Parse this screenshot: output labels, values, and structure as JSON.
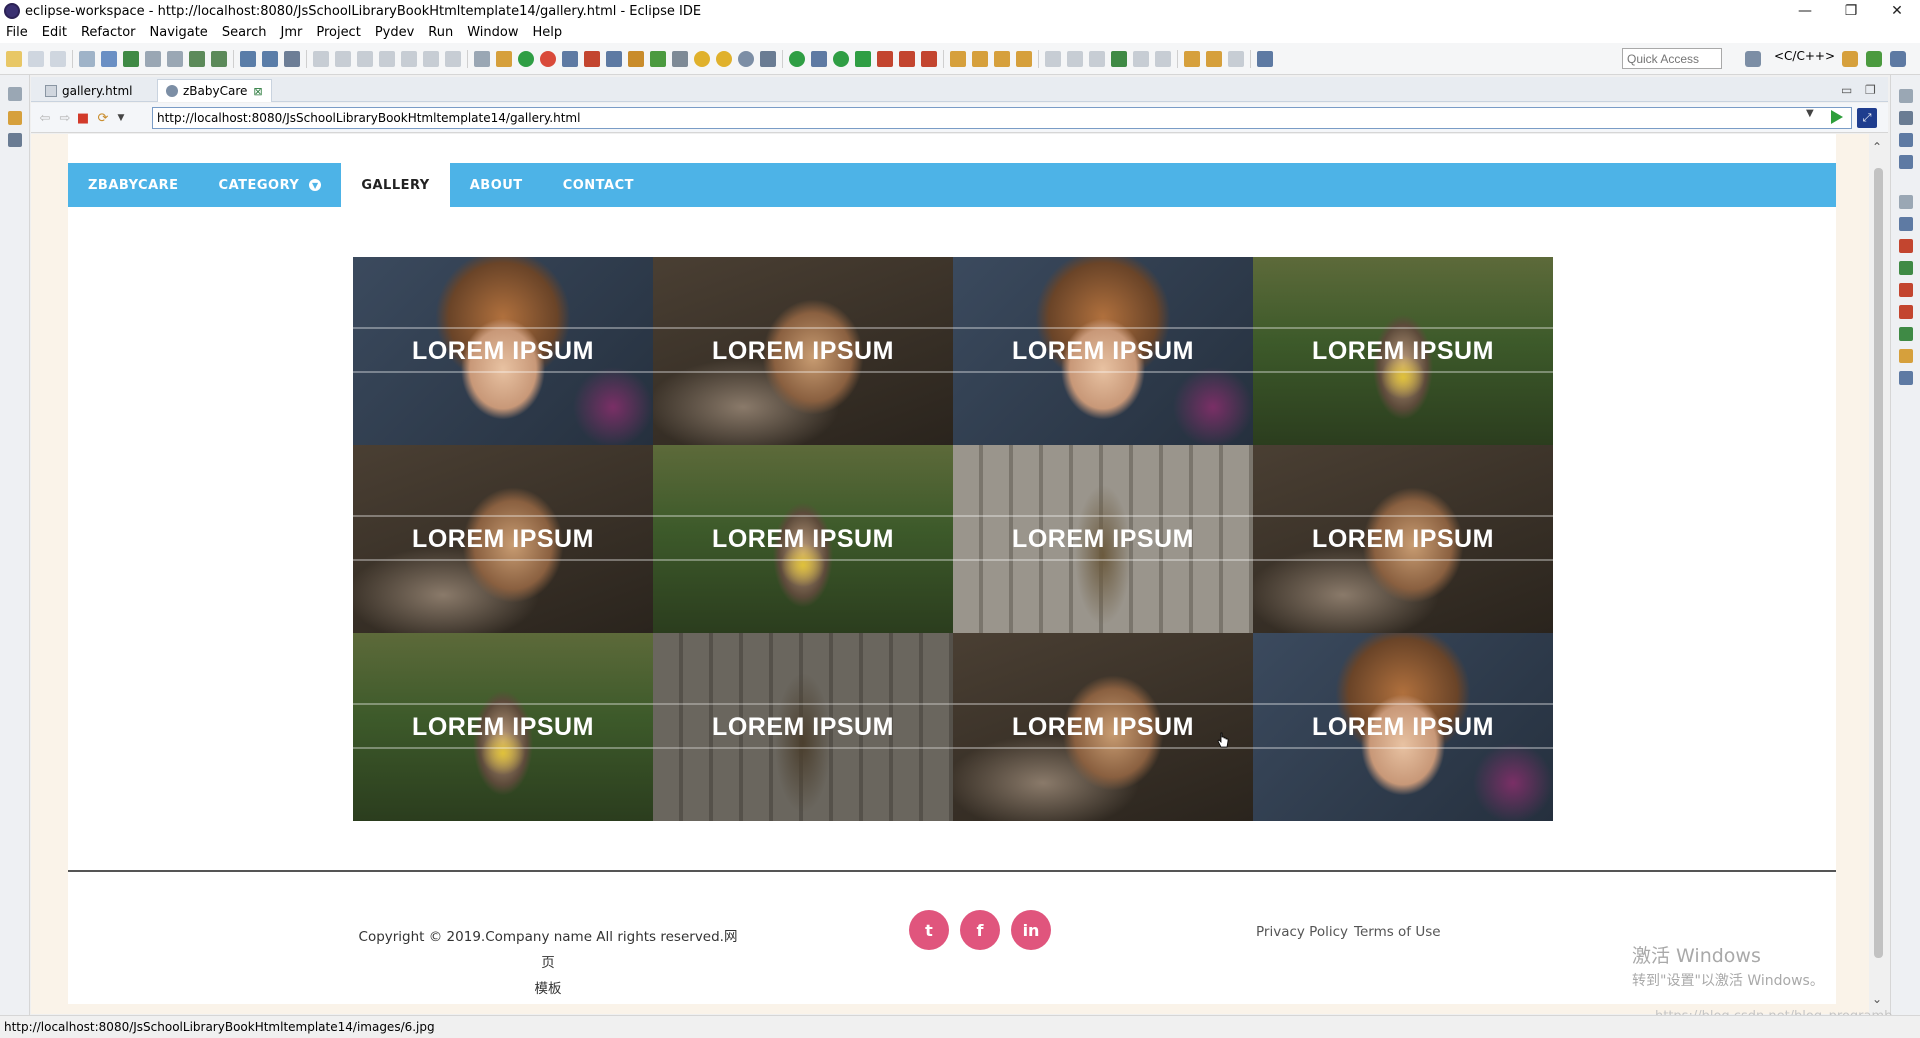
{
  "window": {
    "title": "eclipse-workspace - http://localhost:8080/JsSchoolLibraryBookHtmltemplate14/gallery.html - Eclipse IDE",
    "controls": [
      "—",
      "❐",
      "✕"
    ]
  },
  "menubar": [
    "File",
    "Edit",
    "Refactor",
    "Navigate",
    "Search",
    "Jmr",
    "Project",
    "Pydev",
    "Run",
    "Window",
    "Help"
  ],
  "toolbar": {
    "quick_access": "Quick Access",
    "perspective": "<C/C++>"
  },
  "tabs": [
    {
      "label": "gallery.html",
      "active": false
    },
    {
      "label": "zBabyCare",
      "active": true
    }
  ],
  "browser": {
    "url": "http://localhost:8080/JsSchoolLibraryBookHtmltemplate14/gallery.html"
  },
  "site": {
    "nav": [
      {
        "label": "ZBABYCARE",
        "active": false
      },
      {
        "label": "CATEGORY",
        "active": false,
        "has_dropdown": true
      },
      {
        "label": "GALLERY",
        "active": true
      },
      {
        "label": "ABOUT",
        "active": false
      },
      {
        "label": "CONTACT",
        "active": false
      }
    ],
    "gallery": [
      {
        "caption": "LOREM IPSUM",
        "photo": "girl-face"
      },
      {
        "caption": "LOREM IPSUM",
        "photo": "girl-leaning"
      },
      {
        "caption": "LOREM IPSUM",
        "photo": "girl-face"
      },
      {
        "caption": "LOREM IPSUM",
        "photo": "girl-flower"
      },
      {
        "caption": "LOREM IPSUM",
        "photo": "girl-leaning"
      },
      {
        "caption": "LOREM IPSUM",
        "photo": "girl-flower"
      },
      {
        "caption": "LOREM IPSUM",
        "photo": "girl-camera-arch",
        "hovered": true
      },
      {
        "caption": "LOREM IPSUM",
        "photo": "girl-leaning"
      },
      {
        "caption": "LOREM IPSUM",
        "photo": "girl-flower"
      },
      {
        "caption": "LOREM IPSUM",
        "photo": "girl-camera-arch"
      },
      {
        "caption": "LOREM IPSUM",
        "photo": "girl-leaning"
      },
      {
        "caption": "LOREM IPSUM",
        "photo": "girl-face"
      }
    ],
    "footer": {
      "copyright_line1": "Copyright © 2019.Company name All rights reserved.网页",
      "copyright_line2": "模板",
      "social": [
        {
          "name": "twitter-icon",
          "glyph": "t"
        },
        {
          "name": "facebook-icon",
          "glyph": "f"
        },
        {
          "name": "linkedin-icon",
          "glyph": "in"
        }
      ],
      "links": [
        "Privacy Policy",
        "Terms of Use"
      ]
    }
  },
  "os_watermark": {
    "line1": "激活 Windows",
    "line2": "转到\"设置\"以激活 Windows。"
  },
  "csdn_watermark": "https://blog.csdn.net/blog_programb",
  "statusbar": "http://localhost:8080/JsSchoolLibraryBookHtmltemplate14/images/6.jpg",
  "colors": {
    "nav_bg": "#4db3e7",
    "social_bg": "#e0557d",
    "page_bg": "#faf3e9"
  }
}
